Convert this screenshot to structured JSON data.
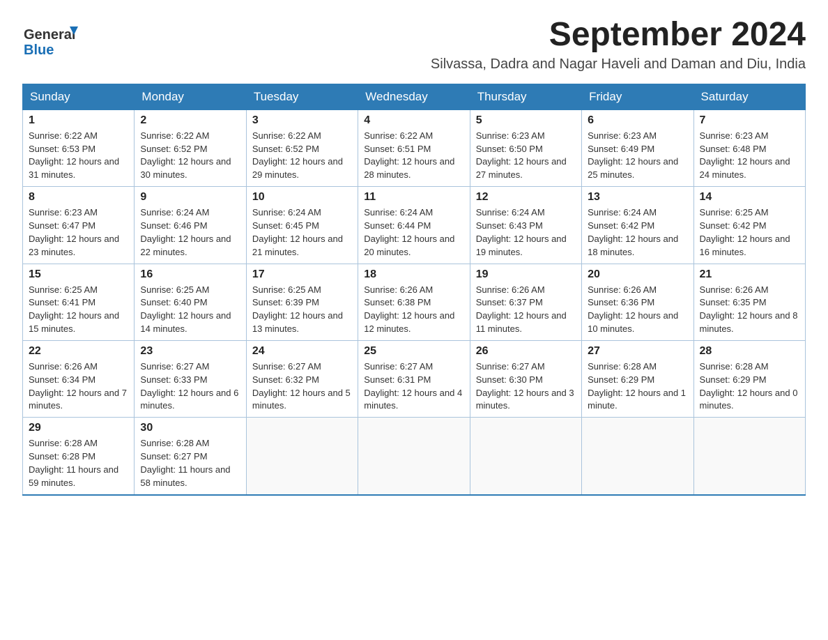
{
  "header": {
    "logo_general": "General",
    "logo_blue": "Blue",
    "main_title": "September 2024",
    "subtitle": "Silvassa, Dadra and Nagar Haveli and Daman and Diu, India"
  },
  "columns": [
    "Sunday",
    "Monday",
    "Tuesday",
    "Wednesday",
    "Thursday",
    "Friday",
    "Saturday"
  ],
  "weeks": [
    [
      {
        "day": "1",
        "sunrise": "Sunrise: 6:22 AM",
        "sunset": "Sunset: 6:53 PM",
        "daylight": "Daylight: 12 hours and 31 minutes."
      },
      {
        "day": "2",
        "sunrise": "Sunrise: 6:22 AM",
        "sunset": "Sunset: 6:52 PM",
        "daylight": "Daylight: 12 hours and 30 minutes."
      },
      {
        "day": "3",
        "sunrise": "Sunrise: 6:22 AM",
        "sunset": "Sunset: 6:52 PM",
        "daylight": "Daylight: 12 hours and 29 minutes."
      },
      {
        "day": "4",
        "sunrise": "Sunrise: 6:22 AM",
        "sunset": "Sunset: 6:51 PM",
        "daylight": "Daylight: 12 hours and 28 minutes."
      },
      {
        "day": "5",
        "sunrise": "Sunrise: 6:23 AM",
        "sunset": "Sunset: 6:50 PM",
        "daylight": "Daylight: 12 hours and 27 minutes."
      },
      {
        "day": "6",
        "sunrise": "Sunrise: 6:23 AM",
        "sunset": "Sunset: 6:49 PM",
        "daylight": "Daylight: 12 hours and 25 minutes."
      },
      {
        "day": "7",
        "sunrise": "Sunrise: 6:23 AM",
        "sunset": "Sunset: 6:48 PM",
        "daylight": "Daylight: 12 hours and 24 minutes."
      }
    ],
    [
      {
        "day": "8",
        "sunrise": "Sunrise: 6:23 AM",
        "sunset": "Sunset: 6:47 PM",
        "daylight": "Daylight: 12 hours and 23 minutes."
      },
      {
        "day": "9",
        "sunrise": "Sunrise: 6:24 AM",
        "sunset": "Sunset: 6:46 PM",
        "daylight": "Daylight: 12 hours and 22 minutes."
      },
      {
        "day": "10",
        "sunrise": "Sunrise: 6:24 AM",
        "sunset": "Sunset: 6:45 PM",
        "daylight": "Daylight: 12 hours and 21 minutes."
      },
      {
        "day": "11",
        "sunrise": "Sunrise: 6:24 AM",
        "sunset": "Sunset: 6:44 PM",
        "daylight": "Daylight: 12 hours and 20 minutes."
      },
      {
        "day": "12",
        "sunrise": "Sunrise: 6:24 AM",
        "sunset": "Sunset: 6:43 PM",
        "daylight": "Daylight: 12 hours and 19 minutes."
      },
      {
        "day": "13",
        "sunrise": "Sunrise: 6:24 AM",
        "sunset": "Sunset: 6:42 PM",
        "daylight": "Daylight: 12 hours and 18 minutes."
      },
      {
        "day": "14",
        "sunrise": "Sunrise: 6:25 AM",
        "sunset": "Sunset: 6:42 PM",
        "daylight": "Daylight: 12 hours and 16 minutes."
      }
    ],
    [
      {
        "day": "15",
        "sunrise": "Sunrise: 6:25 AM",
        "sunset": "Sunset: 6:41 PM",
        "daylight": "Daylight: 12 hours and 15 minutes."
      },
      {
        "day": "16",
        "sunrise": "Sunrise: 6:25 AM",
        "sunset": "Sunset: 6:40 PM",
        "daylight": "Daylight: 12 hours and 14 minutes."
      },
      {
        "day": "17",
        "sunrise": "Sunrise: 6:25 AM",
        "sunset": "Sunset: 6:39 PM",
        "daylight": "Daylight: 12 hours and 13 minutes."
      },
      {
        "day": "18",
        "sunrise": "Sunrise: 6:26 AM",
        "sunset": "Sunset: 6:38 PM",
        "daylight": "Daylight: 12 hours and 12 minutes."
      },
      {
        "day": "19",
        "sunrise": "Sunrise: 6:26 AM",
        "sunset": "Sunset: 6:37 PM",
        "daylight": "Daylight: 12 hours and 11 minutes."
      },
      {
        "day": "20",
        "sunrise": "Sunrise: 6:26 AM",
        "sunset": "Sunset: 6:36 PM",
        "daylight": "Daylight: 12 hours and 10 minutes."
      },
      {
        "day": "21",
        "sunrise": "Sunrise: 6:26 AM",
        "sunset": "Sunset: 6:35 PM",
        "daylight": "Daylight: 12 hours and 8 minutes."
      }
    ],
    [
      {
        "day": "22",
        "sunrise": "Sunrise: 6:26 AM",
        "sunset": "Sunset: 6:34 PM",
        "daylight": "Daylight: 12 hours and 7 minutes."
      },
      {
        "day": "23",
        "sunrise": "Sunrise: 6:27 AM",
        "sunset": "Sunset: 6:33 PM",
        "daylight": "Daylight: 12 hours and 6 minutes."
      },
      {
        "day": "24",
        "sunrise": "Sunrise: 6:27 AM",
        "sunset": "Sunset: 6:32 PM",
        "daylight": "Daylight: 12 hours and 5 minutes."
      },
      {
        "day": "25",
        "sunrise": "Sunrise: 6:27 AM",
        "sunset": "Sunset: 6:31 PM",
        "daylight": "Daylight: 12 hours and 4 minutes."
      },
      {
        "day": "26",
        "sunrise": "Sunrise: 6:27 AM",
        "sunset": "Sunset: 6:30 PM",
        "daylight": "Daylight: 12 hours and 3 minutes."
      },
      {
        "day": "27",
        "sunrise": "Sunrise: 6:28 AM",
        "sunset": "Sunset: 6:29 PM",
        "daylight": "Daylight: 12 hours and 1 minute."
      },
      {
        "day": "28",
        "sunrise": "Sunrise: 6:28 AM",
        "sunset": "Sunset: 6:29 PM",
        "daylight": "Daylight: 12 hours and 0 minutes."
      }
    ],
    [
      {
        "day": "29",
        "sunrise": "Sunrise: 6:28 AM",
        "sunset": "Sunset: 6:28 PM",
        "daylight": "Daylight: 11 hours and 59 minutes."
      },
      {
        "day": "30",
        "sunrise": "Sunrise: 6:28 AM",
        "sunset": "Sunset: 6:27 PM",
        "daylight": "Daylight: 11 hours and 58 minutes."
      },
      null,
      null,
      null,
      null,
      null
    ]
  ]
}
